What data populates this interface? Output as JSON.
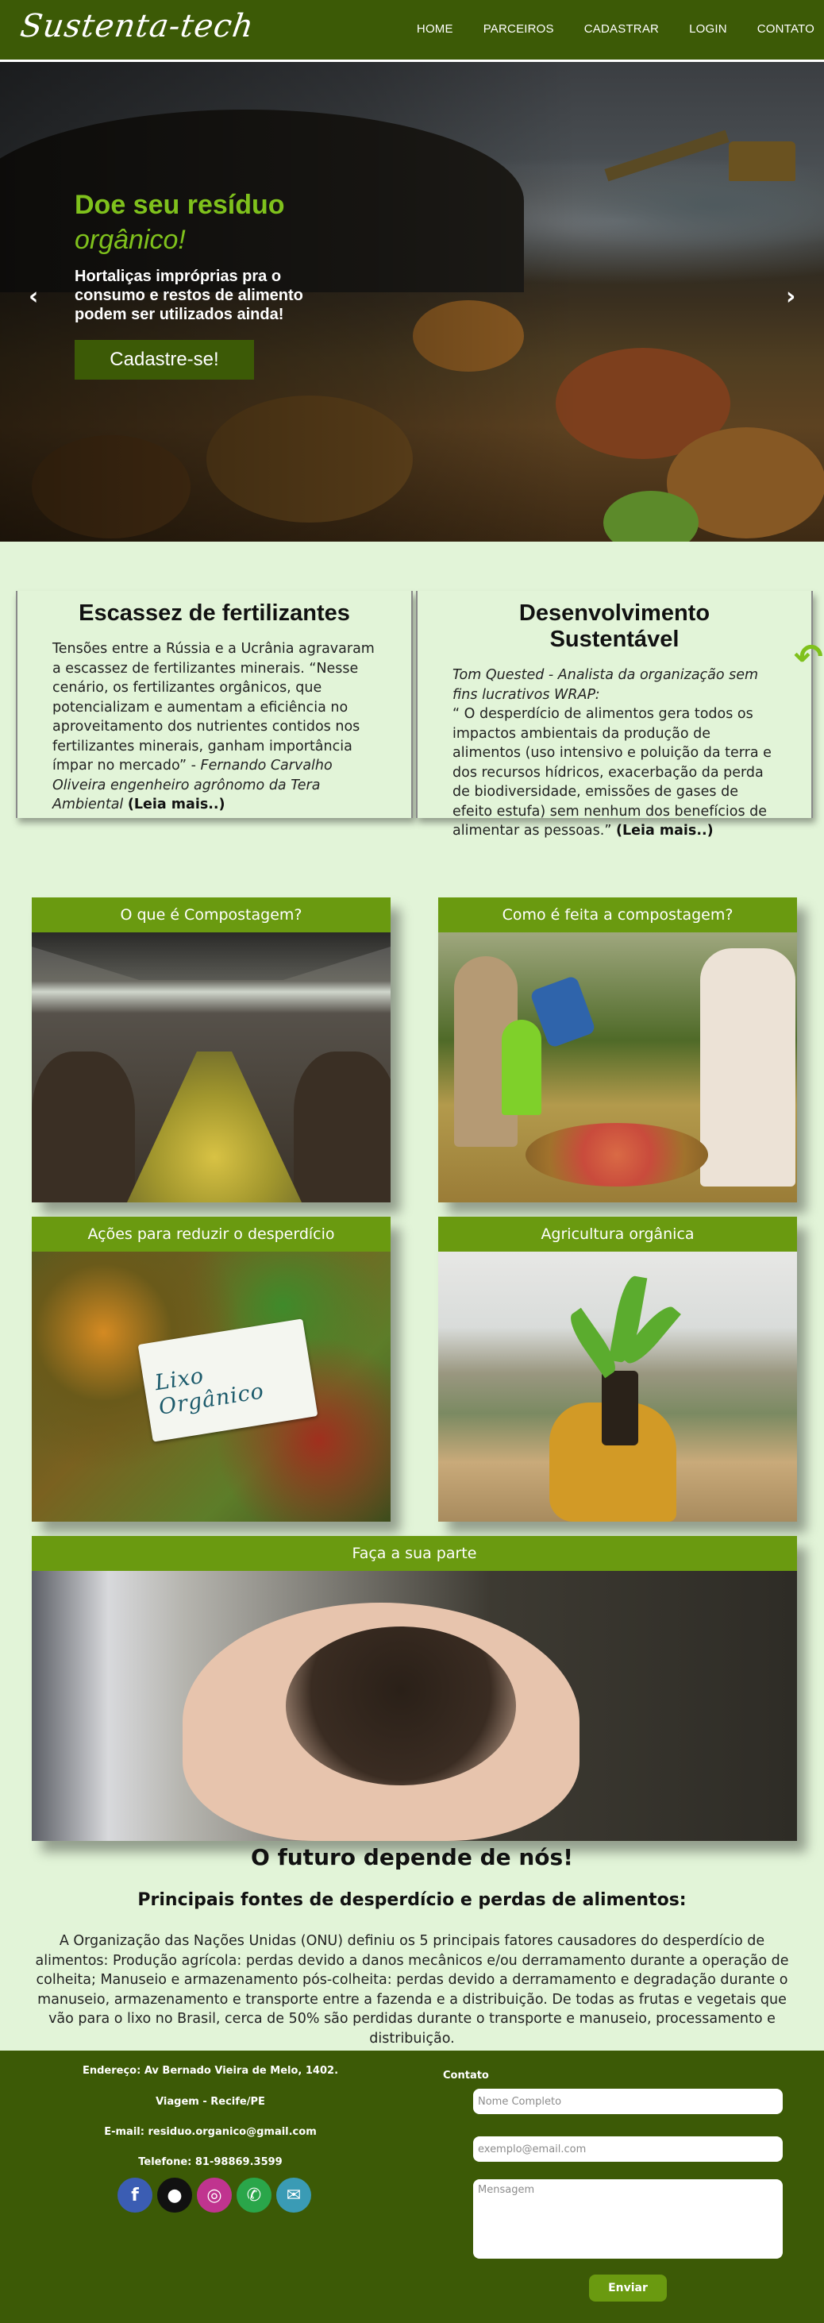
{
  "nav": {
    "brand": "Sustenta-tech",
    "links": [
      "HOME",
      "PARCEIROS",
      "CADASTRAR",
      "LOGIN",
      "CONTATO"
    ]
  },
  "hero": {
    "title_line1": "Doe seu resíduo",
    "title_line2": "orgânico!",
    "subtitle": "Hortaliças impróprias pra o consumo e restos de alimento podem ser utilizados ainda!",
    "cta": "Cadastre-se!",
    "prev_arrow": "‹",
    "next_arrow": "›"
  },
  "cards": {
    "left": {
      "title": "Escassez de fertilizantes",
      "body": "Tensões entre a Rússia e a Ucrânia agravaram a escassez de fertilizantes minerais. “Nesse cenário, os fertilizantes orgânicos, que potencializam e aumentam a eficiência no aproveitamento dos nutrientes contidos nos fertilizantes minerais, ganham importância ímpar no mercado” - ",
      "author": "Fernando Carvalho Oliveira engenheiro agrônomo da Tera Ambiental",
      "read_more": "(Leia mais..)"
    },
    "right": {
      "title": "Desenvolvimento Sustentável",
      "author": "Tom Quested - Analista da organização sem fins lucrativos WRAP:",
      "body": "“ O desperdício de alimentos gera todos os impactos ambientais da produção de alimentos (uso intensivo e poluição da terra e dos recursos hídricos, exacerbação da perda de biodiversidade, emissões de gases de efeito estufa) sem nenhum dos benefícios de alimentar as pessoas.” ",
      "read_more": "(Leia mais..)"
    },
    "side_arrow": "↶"
  },
  "tiles": [
    {
      "label": "O que é Compostagem?"
    },
    {
      "label": "Como é feita a compostagem?"
    },
    {
      "label": "Ações para reduzir o desperdício",
      "image_text": "Lixo Orgânico"
    },
    {
      "label": "Agricultura orgânica"
    },
    {
      "label": "Faça a sua parte"
    }
  ],
  "future": {
    "title": "O futuro depende de nós!",
    "subtitle": "Principais fontes de desperdício e perdas de alimentos:",
    "body": "A Organização das Nações Unidas (ONU) definiu os 5 principais fatores causadores do desperdício de alimentos: Produção agrícola: perdas devido a danos mecânicos e/ou derramamento durante a operação de colheita; Manuseio e armazenamento pós-colheita: perdas devido a derramamento e degradação durante o manuseio, armazenamento e transporte entre a fazenda e a distribuição. De todas as frutas e vegetais que vão para o lixo no Brasil, cerca de 50% são perdidas durante o transporte e manuseio, processamento e distribuição."
  },
  "footer": {
    "address": "Endereço: Av Bernado Vieira de Melo, 1402.",
    "city": "Viagem - Recife/PE",
    "email": "E-mail: residuo.organico@gmail.com",
    "phone": "Telefone: 81-98869.3599",
    "social_icons": [
      "facebook-icon",
      "github-icon",
      "instagram-icon",
      "whatsapp-icon",
      "mail-icon"
    ],
    "social_glyphs": [
      "f",
      "●",
      "◎",
      "✆",
      "✉"
    ],
    "contact_label": "Contato",
    "name_placeholder": "Nome Completo",
    "email_placeholder": "exemplo@email.com",
    "message_placeholder": "Mensagem",
    "send": "Enviar"
  },
  "colors": {
    "nav_bg": "#3c5a06",
    "accent_green": "#7fc11c",
    "tile_header": "#6a9a10",
    "page_bg": "#e2f4d8"
  }
}
